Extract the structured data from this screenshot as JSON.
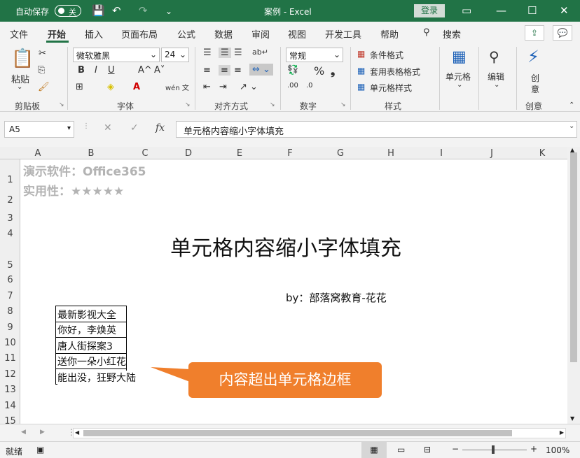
{
  "titlebar": {
    "autosave_label": "自动保存",
    "autosave_state": "关",
    "doc_title": "案例 - Excel",
    "login_label": "登录"
  },
  "tabs": [
    "文件",
    "开始",
    "插入",
    "页面布局",
    "公式",
    "数据",
    "审阅",
    "视图",
    "开发工具",
    "帮助"
  ],
  "search_label": "搜索",
  "ribbon": {
    "clipboard": {
      "paste_label": "粘贴",
      "group_label": "剪贴板"
    },
    "font": {
      "font_name": "微软雅黑",
      "font_size": "24",
      "group_label": "字体",
      "bold": "B",
      "italic": "I",
      "underline": "U",
      "grow": "A^",
      "shrink": "A˅",
      "wen": "wén 文"
    },
    "alignment": {
      "group_label": "对齐方式"
    },
    "number": {
      "format": "常规",
      "group_label": "数字",
      "percent": "%"
    },
    "styles": {
      "cond_format": "条件格式",
      "table_format": "套用表格格式",
      "cell_styles": "单元格样式",
      "group_label": "样式"
    },
    "cells": {
      "label": "单元格"
    },
    "editing": {
      "label": "编辑"
    },
    "ideas": {
      "label1": "创",
      "label2": "意",
      "group_label": "创意"
    }
  },
  "formula_bar": {
    "name_box": "A5",
    "fx": "fx",
    "content": "单元格内容缩小字体填充"
  },
  "columns": [
    "A",
    "B",
    "C",
    "D",
    "E",
    "F",
    "G",
    "H",
    "I",
    "J",
    "K"
  ],
  "rows": [
    "1",
    "2",
    "3",
    "4",
    "5",
    "6",
    "7",
    "8",
    "9",
    "10",
    "11",
    "12",
    "13",
    "14",
    "15"
  ],
  "cells": {
    "a1": "演示软件：Office365",
    "a2": "实用性：★★★★★",
    "title": "单元格内容缩小字体填充",
    "byline": "by：部落窝教育-花花",
    "b9": "最新影视大全",
    "b10": "你好，李焕英",
    "b11": "唐人街探案3",
    "b12": "送你一朵小红花",
    "b13": "能出没，狂野大陆"
  },
  "callout_text": "内容超出单元格边框",
  "status": {
    "ready": "就绪",
    "zoom": "100%"
  },
  "colors": {
    "excel_green": "#217346",
    "callout_orange": "#f07f2c"
  }
}
